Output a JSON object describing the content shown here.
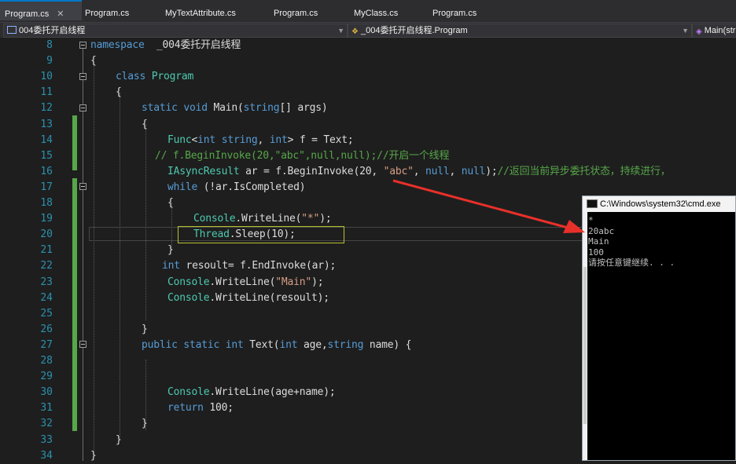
{
  "tabs": [
    {
      "label": "Program.cs",
      "active": true,
      "pinned": "⊕"
    },
    {
      "label": "Program.cs"
    },
    {
      "label": "MyTextAttribute.cs"
    },
    {
      "label": "Program.cs"
    },
    {
      "label": "MyClass.cs"
    },
    {
      "label": "Program.cs"
    }
  ],
  "nav": {
    "project": "004委托开启线程",
    "class": "_004委托开启线程.Program",
    "member": "Main(str"
  },
  "editor": {
    "lines": [
      {
        "n": "8",
        "tokens": [
          [
            "kw",
            "namespace"
          ],
          [
            "",
            "  _004委托开启线程"
          ]
        ]
      },
      {
        "n": "9",
        "tokens": [
          [
            "",
            "{"
          ]
        ]
      },
      {
        "n": "10",
        "tokens": [
          [
            "kw",
            "class "
          ],
          [
            "ty",
            "Program"
          ]
        ]
      },
      {
        "n": "11",
        "tokens": [
          [
            "",
            "{"
          ]
        ]
      },
      {
        "n": "12",
        "tokens": [
          [
            "kw",
            "static "
          ],
          [
            "kw",
            "void "
          ],
          [
            "",
            "Main("
          ],
          [
            "kw",
            "string"
          ],
          [
            "",
            "[] args)"
          ]
        ]
      },
      {
        "n": "13",
        "tokens": [
          [
            "",
            "{"
          ]
        ]
      },
      {
        "n": "14",
        "tokens": [
          [
            "ty",
            "Func"
          ],
          [
            "",
            "<"
          ],
          [
            "kw",
            "int"
          ],
          [
            ",",
            " "
          ],
          [
            "kw",
            "string"
          ],
          [
            ", "
          ],
          [
            "kw",
            "int"
          ],
          [
            "",
            "> f = Text;"
          ]
        ]
      },
      {
        "n": "15",
        "tokens": [
          [
            "cm",
            "// f.BeginInvoke(20,\"abc\",null,null);//开启一个线程"
          ]
        ]
      },
      {
        "n": "16",
        "tokens": [
          [
            "ty",
            "IAsyncResult"
          ],
          [
            "",
            " ar = f.BeginInvoke(20, "
          ],
          [
            "st",
            "\"abc\""
          ],
          [
            "",
            ", "
          ],
          [
            "kw",
            "null"
          ],
          [
            "",
            ", "
          ],
          [
            "kw",
            "null"
          ],
          [
            "",
            ");"
          ],
          [
            "cm",
            "//返回当前异步委托状态，持续进行，"
          ]
        ]
      },
      {
        "n": "17",
        "tokens": [
          [
            "kw",
            "while "
          ],
          [
            "",
            "(!ar.IsCompleted)"
          ]
        ]
      },
      {
        "n": "18",
        "tokens": [
          [
            "",
            "{"
          ]
        ]
      },
      {
        "n": "19",
        "tokens": [
          [
            "ty",
            "Console"
          ],
          [
            "",
            ".WriteLine("
          ],
          [
            "st",
            "\"*\""
          ],
          [
            "",
            ");"
          ]
        ]
      },
      {
        "n": "20",
        "tokens": [
          [
            "ty",
            "Thread"
          ],
          [
            "",
            ".Sleep(10);"
          ]
        ]
      },
      {
        "n": "21",
        "tokens": [
          [
            "",
            "}"
          ]
        ]
      },
      {
        "n": "22",
        "tokens": [
          [
            "kw",
            "int "
          ],
          [
            "",
            "resoult= f.EndInvoke(ar);"
          ]
        ]
      },
      {
        "n": "23",
        "tokens": [
          [
            "ty",
            "Console"
          ],
          [
            "",
            ".WriteLine("
          ],
          [
            "st",
            "\"Main\""
          ],
          [
            "",
            ");"
          ]
        ]
      },
      {
        "n": "24",
        "tokens": [
          [
            "ty",
            "Console"
          ],
          [
            "",
            ".WriteLine(resoult);"
          ]
        ]
      },
      {
        "n": "25",
        "tokens": []
      },
      {
        "n": "26",
        "tokens": [
          [
            "",
            "}"
          ]
        ]
      },
      {
        "n": "27",
        "tokens": [
          [
            "kw",
            "public "
          ],
          [
            "kw",
            "static "
          ],
          [
            "kw",
            "int "
          ],
          [
            "",
            "Text("
          ],
          [
            "kw",
            "int "
          ],
          [
            "",
            "age,"
          ],
          [
            "kw",
            "string "
          ],
          [
            "",
            "name) {"
          ]
        ]
      },
      {
        "n": "28",
        "tokens": []
      },
      {
        "n": "29",
        "tokens": []
      },
      {
        "n": "30",
        "tokens": [
          [
            "ty",
            "Console"
          ],
          [
            "",
            ".WriteLine(age+name);"
          ]
        ]
      },
      {
        "n": "31",
        "tokens": [
          [
            "kw",
            "return "
          ],
          [
            "",
            "100;"
          ]
        ]
      },
      {
        "n": "32",
        "tokens": [
          [
            "",
            "}"
          ]
        ]
      },
      {
        "n": "33",
        "tokens": [
          [
            "",
            "}"
          ]
        ]
      },
      {
        "n": "34",
        "tokens": [
          [
            "",
            "}"
          ]
        ]
      }
    ]
  },
  "console": {
    "title": "C:\\Windows\\system32\\cmd.exe",
    "output": "*\n20abc\nMain\n100\n请按任意键继续. . ."
  },
  "colors": {
    "accent": "#007acc",
    "arrow": "#e8302a",
    "highlight_box": "#b7c22f"
  }
}
